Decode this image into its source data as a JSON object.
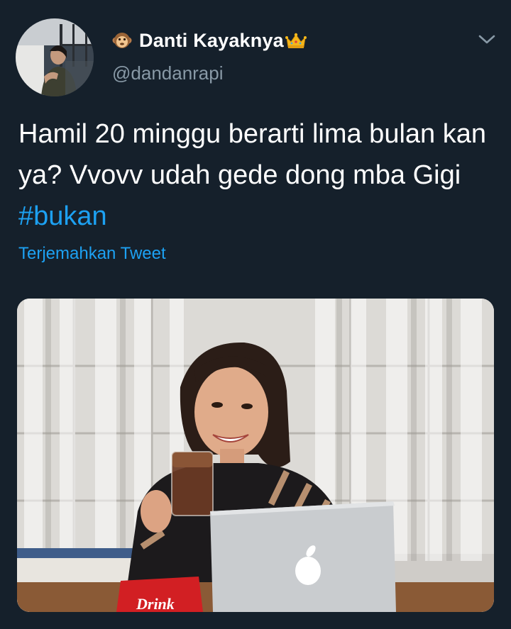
{
  "user": {
    "display_name": "Danti Kayaknya",
    "handle": "@dandanrapi",
    "name_emoji_left": "monkey-face-emoji",
    "name_emoji_right": "crown-emoji"
  },
  "tweet": {
    "text_before_hashtag": "Hamil 20 minggu berarti lima bulan kan ya? Vvovv udah gede dong mba Gigi ",
    "hashtag": "#bukan",
    "translate_label": "Terjemahkan Tweet"
  },
  "media": {
    "product_label": "Drink"
  },
  "colors": {
    "background": "#15202b",
    "text_primary": "#ffffff",
    "text_secondary": "#8899a6",
    "accent": "#1da1f2"
  }
}
